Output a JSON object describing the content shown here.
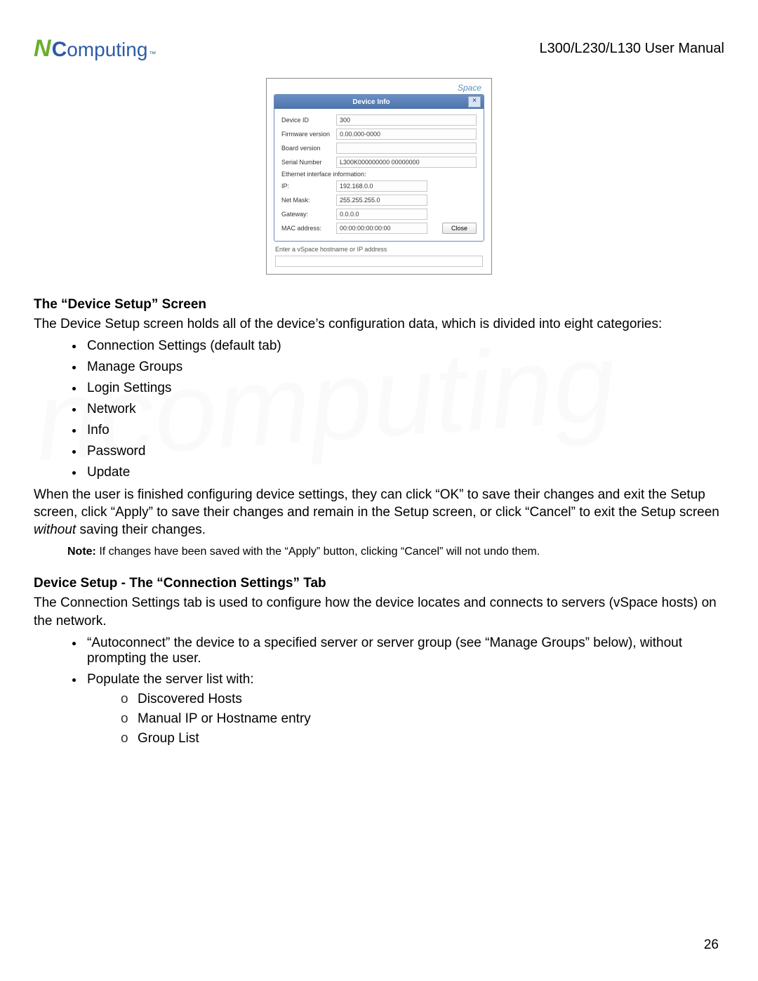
{
  "header": {
    "logo_rest": "omputing",
    "doc_title": "L300/L230/L130 User Manual"
  },
  "screenshot": {
    "space_hint": "Space",
    "dialog_title": "Device Info",
    "close_x": "×",
    "rows": {
      "device_id_label": "Device ID",
      "device_id_val": "300",
      "firmware_label": "Firmware version",
      "firmware_val": "0.00.000-0000",
      "board_label": "Board version",
      "board_val": "",
      "serial_label": "Serial Number",
      "serial_val": "L300K000000000 00000000"
    },
    "eth_header": "Ethernet interface information:",
    "eth": {
      "ip_label": "IP:",
      "ip_val": "192.168.0.0",
      "mask_label": "Net Mask:",
      "mask_val": "255.255.255.0",
      "gw_label": "Gateway:",
      "gw_val": "0.0.0.0",
      "mac_label": "MAC address:",
      "mac_val": "00:00:00:00:00:00"
    },
    "close_btn": "Close",
    "enter_host": "Enter a vSpace hostname or IP address"
  },
  "section1": {
    "heading": "The “Device Setup” Screen",
    "intro": "The Device Setup screen holds all of the device’s configuration data, which is divided into eight categories:",
    "bullets": [
      "Connection Settings (default tab)",
      "Manage Groups",
      "Login Settings",
      "Network",
      "Info",
      "Password",
      "Update"
    ],
    "after_a": "When the user is finished configuring device settings, they can click “OK” to save their changes and exit the Setup screen, click “Apply” to save their changes and remain in the Setup screen, or click “Cancel” to exit the Setup screen ",
    "after_em": "without",
    "after_b": " saving their changes.",
    "note_label": "Note:",
    "note_text": " If changes have been saved with the “Apply” button, clicking “Cancel” will not undo them."
  },
  "section2": {
    "heading": "Device Setup - The “Connection Settings” Tab",
    "intro": "The Connection Settings tab is used to configure how the device locates and connects to servers (vSpace hosts) on the network.",
    "bullet1": "“Autoconnect” the device to a specified server or server group (see “Manage Groups” below), without prompting the user.",
    "bullet2": "Populate the server list with:",
    "sub": [
      "Discovered Hosts",
      "Manual IP or Hostname entry",
      "Group List"
    ]
  },
  "page_number": "26",
  "watermark": "ncomputing"
}
